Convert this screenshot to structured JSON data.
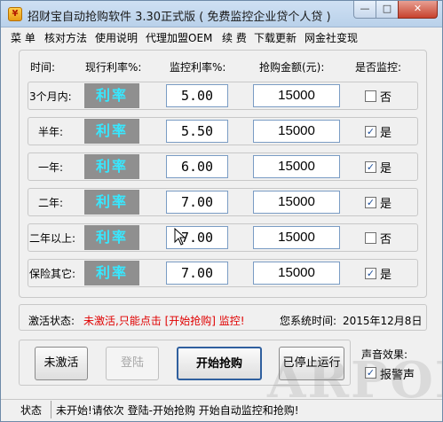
{
  "window": {
    "title": "招财宝自动抢购软件 3.30正式版 ( 免费监控企业贷个人贷 )",
    "minimize_glyph": "—",
    "maximize_glyph": "□",
    "close_glyph": "✕"
  },
  "menu": [
    "菜 单",
    "核对方法",
    "使用说明",
    "代理加盟OEM",
    "续 费",
    "下载更新",
    "网金社变现"
  ],
  "columns": {
    "time": "时间:",
    "current_rate": "现行利率%:",
    "monitor_rate": "监控利率%:",
    "amount": "抢购金额(元):",
    "monitor": "是否监控:"
  },
  "rows": [
    {
      "label": "3个月内:",
      "rate_button": "利率",
      "monitor_rate": "5.00",
      "amount": "15000",
      "checked": false,
      "check_label": "否"
    },
    {
      "label": "半年:",
      "rate_button": "利率",
      "monitor_rate": "5.50",
      "amount": "15000",
      "checked": true,
      "check_label": "是"
    },
    {
      "label": "一年:",
      "rate_button": "利率",
      "monitor_rate": "6.00",
      "amount": "15000",
      "checked": true,
      "check_label": "是"
    },
    {
      "label": "二年:",
      "rate_button": "利率",
      "monitor_rate": "7.00",
      "amount": "15000",
      "checked": true,
      "check_label": "是"
    },
    {
      "label": "二年以上:",
      "rate_button": "利率",
      "monitor_rate": "7.00",
      "amount": "15000",
      "checked": false,
      "check_label": "否"
    },
    {
      "label": "保险其它:",
      "rate_button": "利率",
      "monitor_rate": "7.00",
      "amount": "15000",
      "checked": true,
      "check_label": "是"
    }
  ],
  "activation": {
    "label": "激活状态:",
    "value": "未激活,只能点击 [开始抢购] 监控!",
    "time_label": "您系统时间:",
    "time_value": "2015年12月8日"
  },
  "buttons": {
    "activate": "未激活",
    "login": "登陆",
    "start": "开始抢购",
    "stopped": "已停止运行"
  },
  "sound": {
    "title": "声音效果:",
    "alarm_label": "报警声",
    "alarm_checked": true
  },
  "statusbar": {
    "label": "状态",
    "message": "未开始!请依次 登陆-开始抢购 开始自动监控和抢购!"
  },
  "watermark": "ARPON",
  "colors": {
    "rate_button_bg": "#8f8f8f",
    "rate_button_text": "#37e8ff",
    "warning_text": "#e00000"
  }
}
